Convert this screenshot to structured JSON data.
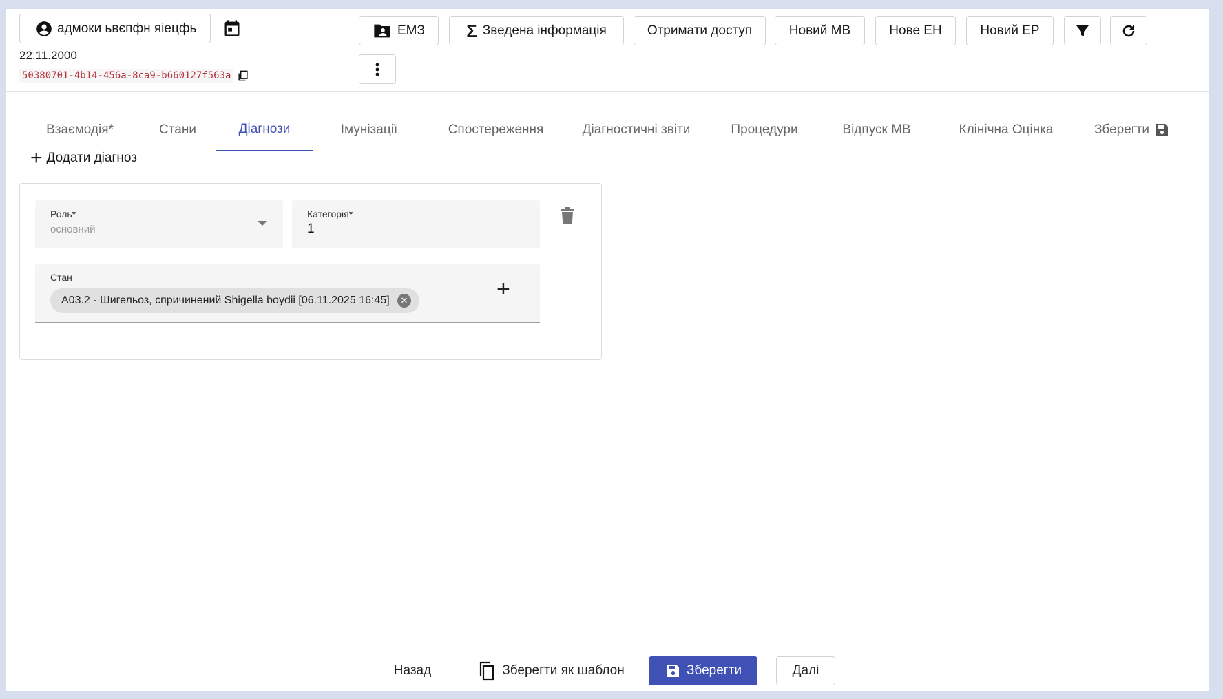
{
  "patient": {
    "name": "адмоки ьвєпфн яіецфь",
    "birth_date": "22.11.2000",
    "id": "50380701-4b14-456a-8ca9-b660127f563a"
  },
  "toolbar": {
    "emz": "ЕМЗ",
    "summary": "Зведена інформація",
    "get_access": "Отримати доступ",
    "new_mv": "Новий МВ",
    "new_eh": "Нове ЕН",
    "new_er": "Новий ЕР"
  },
  "tabs": [
    {
      "label": "Взаємодія*"
    },
    {
      "label": "Стани"
    },
    {
      "label": "Діагнози"
    },
    {
      "label": "Імунізації"
    },
    {
      "label": "Спостереження"
    },
    {
      "label": "Діагностичні звіти"
    },
    {
      "label": "Процедури"
    },
    {
      "label": "Відпуск МВ"
    },
    {
      "label": "Клінічна Оцінка"
    },
    {
      "label": "Зберегти"
    }
  ],
  "active_tab": "Діагнози",
  "add_diagnosis_label": "Додати діагноз",
  "diagnosis": {
    "role_label": "Роль*",
    "role_value": "основний",
    "category_label": "Категорія*",
    "category_value": "1",
    "condition_label": "Стан",
    "condition_chip": "A03.2 - Шигельоз, спричинений Shigella boydii [06.11.2025 16:45]"
  },
  "footer": {
    "back": "Назад",
    "save_template": "Зберегти як шаблон",
    "save": "Зберегти",
    "next": "Далі"
  },
  "colors": {
    "accent": "#3f51b5",
    "id_text": "#b5333d",
    "background": "#d7deed"
  }
}
